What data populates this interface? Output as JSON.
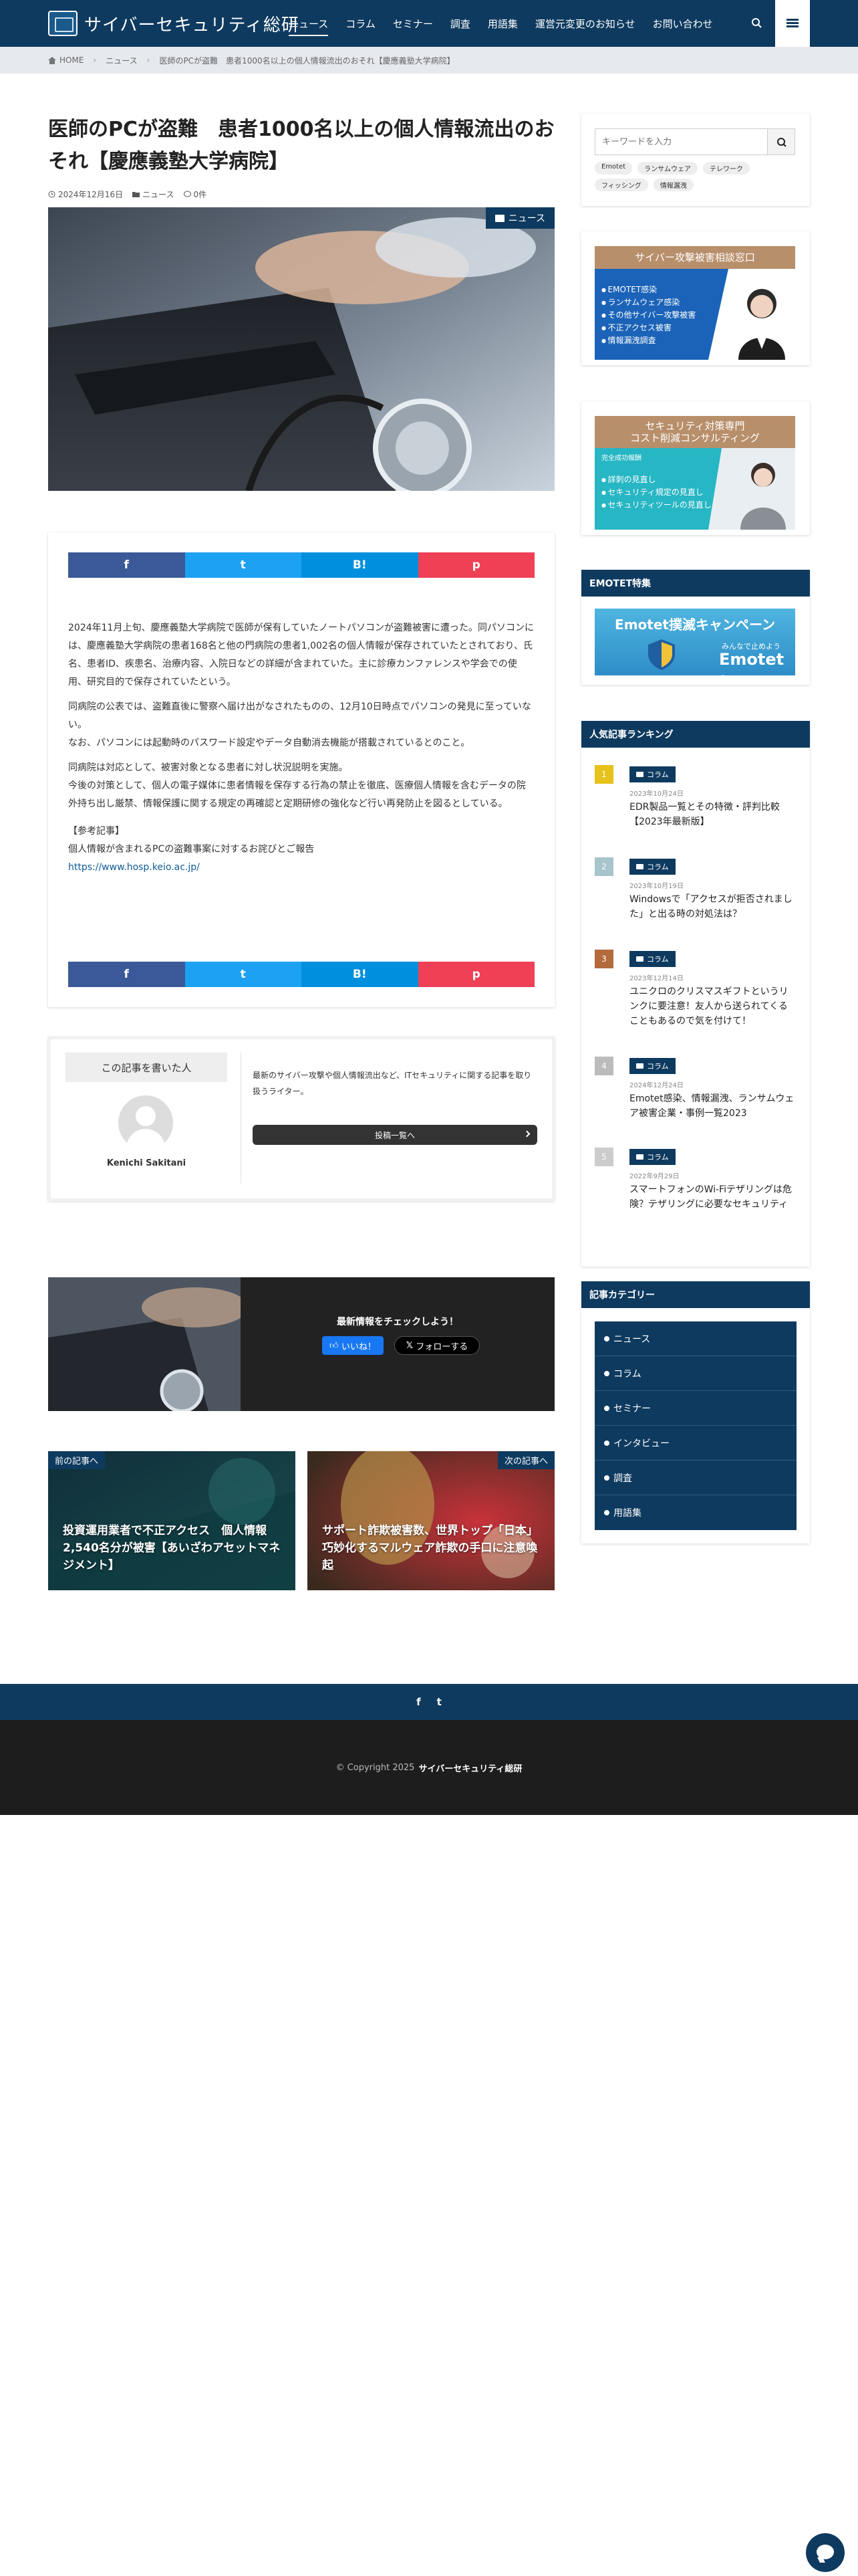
{
  "header": {
    "site_name": "サイバーセキュリティ総研",
    "nav": [
      "ニュース",
      "コラム",
      "セミナー",
      "調査",
      "用語集",
      "運営元変更のお知らせ",
      "お問い合わせ"
    ]
  },
  "breadcrumb": {
    "home": "HOME",
    "category": "ニュース",
    "current": "医師のPCが盗難　患者1000名以上の個人情報流出のおそれ【慶應義塾大学病院】"
  },
  "article": {
    "title": "医師のPCが盗難　患者1000名以上の個人情報流出のおそれ【慶應義塾大学病院】",
    "date": "2024年12月16日",
    "category": "ニュース",
    "comments": "0件",
    "badge": "ニュース",
    "paragraphs": [
      "2024年11月上旬、慶應義塾大学病院で医師が保有していたノートパソコンが盗難被害に遭った。同パソコンには、慶應義塾大学病院の患者168名と他の門病院の患者1,002名の個人情報が保存されていたとされており、氏名、患者ID、疾患名、治療内容、入院日などの詳細が含まれていた。主に診療カンファレンスや学会での使用、研究目的で保存されていたという。",
      "同病院の公表では、盗難直後に警察へ届け出がなされたものの、12月10日時点でパソコンの発見に至っていない。",
      "なお、パソコンには起動時のパスワード設定やデータ自動消去機能が搭載されているとのこと。",
      "同病院は対応として、被害対象となる患者に対し状況説明を実施。",
      "今後の対策として、個人の電子媒体に患者情報を保存する行為の禁止を徹底、医療個人情報を含むデータの院外持ち出し厳禁、情報保護に関する規定の再確認と定期研修の強化など行い再発防止を図るとしている。"
    ],
    "ref_heading": "【参考記事】",
    "ref_title": "個人情報が含まれるPCの盗難事案に対するお詫びとご報告",
    "ref_url": "https://www.hosp.keio.ac.jp/"
  },
  "share": {
    "fb": "f",
    "tw": "t",
    "hb": "B!",
    "pk": "p"
  },
  "author": {
    "heading": "この記事を書いた人",
    "name": "Kenichi Sakitani",
    "desc": "最新のサイバー攻撃や個人情報流出など、ITセキュリティに関する記事を取り扱うライター。",
    "button": "投稿一覧へ"
  },
  "follow": {
    "title": "最新情報をチェックしよう！",
    "like": "いいね！",
    "x": "フォローする"
  },
  "prev_next": {
    "prev_label": "前の記事へ",
    "prev_title": "投資運用業者で不正アクセス　個人情報2,540名分が被害【あいざわアセットマネジメント】",
    "next_label": "次の記事へ",
    "next_title": "サポート詐欺被害数、世界トップ「日本」　巧妙化するマルウェア詐欺の手口に注意喚起"
  },
  "sidebar": {
    "search_placeholder": "キーワードを入力",
    "tags": [
      "Emotet",
      "ランサムウェア",
      "テレワーク",
      "フィッシング",
      "情報漏洩"
    ],
    "banner1": {
      "head": "サイバー攻撃被害相談窓口",
      "items": [
        "EMOTET感染",
        "ランサムウェア感染",
        "その他サイバー攻撃被害",
        "不正アクセス被害",
        "情報漏洩調査"
      ]
    },
    "banner2": {
      "head1": "セキュリティ対策専門",
      "head2": "コスト削減コンサルティング",
      "tagline": "完全成功報酬",
      "items": [
        "詳刺の見直し",
        "セキュリティ規定の見直し",
        "セキュリティツールの見直し"
      ]
    },
    "emotet_title": "EMOTET特集",
    "emotet_banner": {
      "l1": "Emotet撲滅キャンペーン",
      "l2": "みんなで止めよう",
      "l3": "Emotet ！"
    },
    "ranking_title": "人気記事ランキング",
    "ranking": [
      {
        "num": "1",
        "cat": "コラム",
        "date": "2023年10月24日",
        "title": "EDR製品一覧とその特徴・評判比較【2023年最新版】"
      },
      {
        "num": "2",
        "cat": "コラム",
        "date": "2023年10月19日",
        "title": "Windowsで「アクセスが拒否されました」と出る時の対処法は？"
      },
      {
        "num": "3",
        "cat": "コラム",
        "date": "2023年12月14日",
        "title": "ユニクロのクリスマスギフトというリンクに要注意！友人から送られてくることもあるので気を付けて！"
      },
      {
        "num": "4",
        "cat": "コラム",
        "date": "2024年12月24日",
        "title": "Emotet感染、情報漏洩、ランサムウェア被害企業・事例一覧2023"
      },
      {
        "num": "5",
        "cat": "コラム",
        "date": "2022年9月29日",
        "title": "スマートフォンのWi-Fiテザリングは危険？テザリングに必要なセキュリティ"
      }
    ],
    "category_title": "記事カテゴリー",
    "categories": [
      "ニュース",
      "コラム",
      "セミナー",
      "インタビュー",
      "調査",
      "用語集"
    ]
  },
  "footer": {
    "social": [
      "f",
      "t"
    ],
    "copyright": "© Copyright 2025",
    "site": "サイバーセキュリティ総研"
  },
  "colors": {
    "primary": "#0e3a5f",
    "banner_head": "#b88f6b",
    "rank1": "#e6c21a",
    "rank2": "#a8c4cc",
    "rank3": "#b36b3c",
    "rank4": "#bbbbbb",
    "rank5": "#cccccc"
  }
}
